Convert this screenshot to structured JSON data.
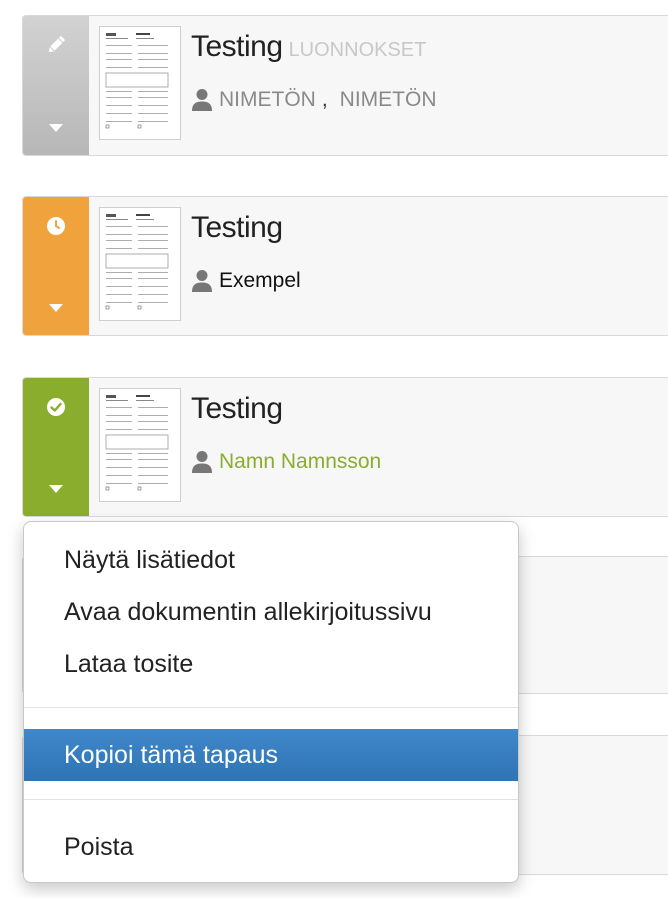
{
  "documents": [
    {
      "title": "Testing",
      "status_tag": "LUONNOKSET",
      "status_icon": "pencil-icon",
      "status_color": "#c4c4c4",
      "signers": [
        "NIMETÖN",
        "NIMETÖN"
      ],
      "signer_separator": ",",
      "signer_color": "#8a8a8a"
    },
    {
      "title": "Testing",
      "status_icon": "clock-icon",
      "status_color": "#f0a23c",
      "signers": [
        "Exempel"
      ],
      "signer_color": "#111111"
    },
    {
      "title": "Testing",
      "status_icon": "check-circle-icon",
      "status_color": "#8aad2e",
      "signers": [
        "Namn Namnsson"
      ],
      "signer_color": "#8aad2e"
    }
  ],
  "context_menu": {
    "items": [
      "Näytä lisätiedot",
      "Avaa dokumentin allekirjoitussivu",
      "Lataa tosite",
      "Kopioi tämä tapaus",
      "Poista"
    ],
    "highlighted_item": "Kopioi tämä tapaus"
  }
}
